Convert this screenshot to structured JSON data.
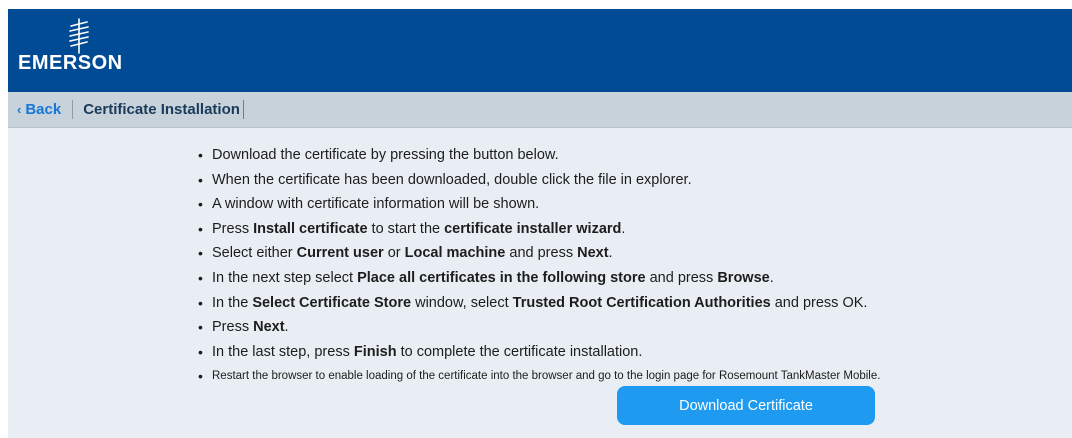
{
  "brand": {
    "name": "EMERSON",
    "header_color": "#004b93",
    "accent_color": "#1e9bf0"
  },
  "nav": {
    "back_label": "Back",
    "title": "Certificate Installation"
  },
  "instructions": [
    [
      {
        "t": "Download the certificate by pressing the button below."
      }
    ],
    [
      {
        "t": "When the certificate has been downloaded, double click the file in explorer."
      }
    ],
    [
      {
        "t": "A window with certificate information will be shown."
      }
    ],
    [
      {
        "t": "Press "
      },
      {
        "t": "Install certificate",
        "b": true
      },
      {
        "t": " to start the "
      },
      {
        "t": "certificate installer wizard",
        "b": true
      },
      {
        "t": "."
      }
    ],
    [
      {
        "t": "Select either "
      },
      {
        "t": "Current user",
        "b": true
      },
      {
        "t": " or "
      },
      {
        "t": "Local machine",
        "b": true
      },
      {
        "t": " and press "
      },
      {
        "t": "Next",
        "b": true
      },
      {
        "t": "."
      }
    ],
    [
      {
        "t": "In the next step select "
      },
      {
        "t": "Place all certificates in the following store",
        "b": true
      },
      {
        "t": " and press "
      },
      {
        "t": "Browse",
        "b": true
      },
      {
        "t": "."
      }
    ],
    [
      {
        "t": "In the "
      },
      {
        "t": "Select Certificate Store",
        "b": true
      },
      {
        "t": " window, select "
      },
      {
        "t": "Trusted Root Certification Authorities",
        "b": true
      },
      {
        "t": " and press OK."
      }
    ],
    [
      {
        "t": "Press "
      },
      {
        "t": "Next",
        "b": true
      },
      {
        "t": "."
      }
    ],
    [
      {
        "t": "In the last step, press "
      },
      {
        "t": "Finish",
        "b": true
      },
      {
        "t": " to complete the certificate installation."
      }
    ],
    [
      {
        "t": "Restart the browser to enable loading of the certificate into the browser and go to the login page for Rosemount TankMaster Mobile."
      }
    ]
  ],
  "download_button": {
    "label": "Download Certificate"
  }
}
